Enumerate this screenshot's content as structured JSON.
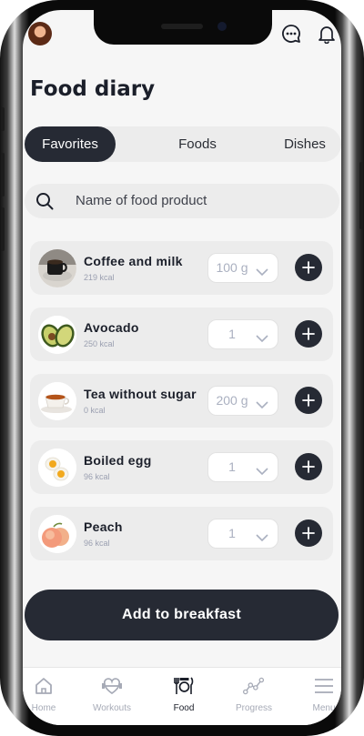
{
  "colors": {
    "dark": "#262a34",
    "surface": "#ececec",
    "screen_bg": "#f6f6f6",
    "muted": "#9a9fb0",
    "white": "#ffffff"
  },
  "header": {
    "title": "Food diary",
    "icons": [
      "user-avatar",
      "chat-bubble-icon",
      "bell-icon"
    ]
  },
  "tabs": {
    "active": "Favorites",
    "items": [
      {
        "label": "Favorites"
      },
      {
        "label": "Foods"
      },
      {
        "label": "Dishes"
      }
    ]
  },
  "search": {
    "placeholder": "Name of food product",
    "icon": "search-icon"
  },
  "foods": [
    {
      "name": "Coffee and milk",
      "kcal": "219 kcal",
      "quantity": "100 g",
      "icon": "coffee-cup-image"
    },
    {
      "name": "Avocado",
      "kcal": "250 kcal",
      "quantity": "1",
      "icon": "avocado-image"
    },
    {
      "name": "Tea without sugar",
      "kcal": "0 kcal",
      "quantity": "200 g",
      "icon": "tea-cup-image"
    },
    {
      "name": "Boiled egg",
      "kcal": "96 kcal",
      "quantity": "1",
      "icon": "boiled-egg-image"
    },
    {
      "name": "Peach",
      "kcal": "96 kcal",
      "quantity": "1",
      "icon": "peach-image"
    }
  ],
  "action": {
    "label": "Add to breakfast"
  },
  "nav": {
    "active": "Food",
    "items": [
      {
        "label": "Home",
        "icon": "home-icon"
      },
      {
        "label": "Workouts",
        "icon": "dumbbell-heart-icon"
      },
      {
        "label": "Food",
        "icon": "fork-knife-plate-icon"
      },
      {
        "label": "Progress",
        "icon": "progress-chart-icon"
      },
      {
        "label": "Menu",
        "icon": "hamburger-menu-icon"
      }
    ]
  }
}
